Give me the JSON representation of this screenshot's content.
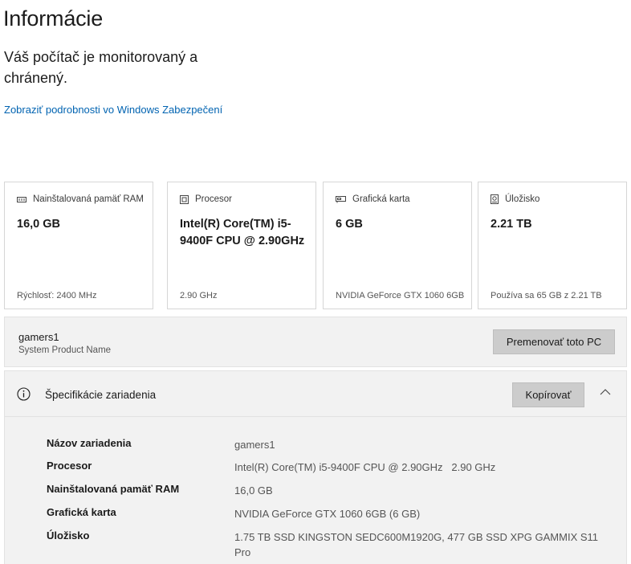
{
  "page": {
    "title": "Informácie",
    "status": "Váš počítač je monitorovaný a chránený.",
    "details_link": "Zobraziť podrobnosti vo Windows Zabezpečení"
  },
  "cards": [
    {
      "icon": "memory-icon",
      "label": "Nainštalovaná pamäť RAM",
      "value": "16,0 GB",
      "foot": "Rýchlosť: 2400 MHz"
    },
    {
      "icon": "processor-icon",
      "label": "Procesor",
      "value": "Intel(R) Core(TM) i5-9400F CPU @ 2.90GHz",
      "foot": "2.90 GHz"
    },
    {
      "icon": "graphics-card-icon",
      "label": "Grafická karta",
      "value": "6 GB",
      "foot": "NVIDIA GeForce GTX 1060 6GB"
    },
    {
      "icon": "storage-icon",
      "label": "Úložisko",
      "value": "2.21 TB",
      "foot": "Používa sa 65 GB z 2.21 TB"
    }
  ],
  "pc": {
    "name": "gamers1",
    "model": "System Product Name",
    "rename_label": "Premenovať toto PC"
  },
  "specs": {
    "header": "Špecifikácie zariadenia",
    "copy_label": "Kopírovať",
    "rows": [
      {
        "key": "Názov zariadenia",
        "value": "gamers1"
      },
      {
        "key": "Procesor",
        "value": "Intel(R) Core(TM) i5-9400F CPU @ 2.90GHz   2.90 GHz"
      },
      {
        "key": "Nainštalovaná pamäť RAM",
        "value": "16,0 GB"
      },
      {
        "key": "Grafická karta",
        "value": "NVIDIA GeForce GTX 1060 6GB (6 GB)"
      },
      {
        "key": "Úložisko",
        "value": "1.75 TB SSD KINGSTON SEDC600M1920G, 477 GB SSD XPG GAMMIX S11 Pro"
      }
    ]
  },
  "colors": {
    "link": "#0063b1",
    "panel": "#f2f2f2",
    "button": "#cccccc"
  }
}
